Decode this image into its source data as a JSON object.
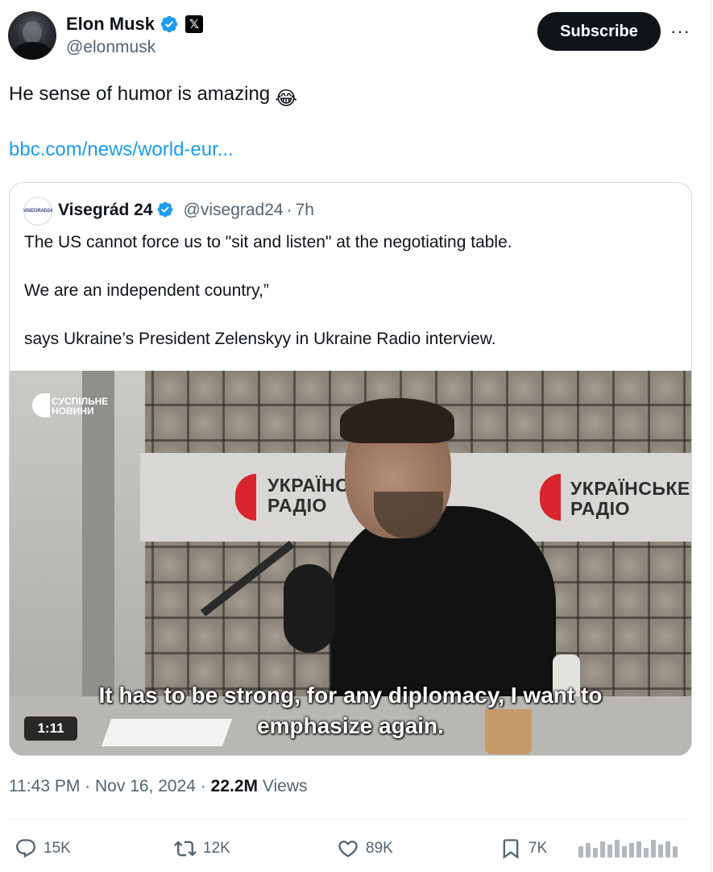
{
  "author": {
    "name": "Elon Musk",
    "handle": "@elonmusk",
    "avatar_icon": "profile-photo",
    "verified_icon": "verified-badge-icon",
    "affiliate_icon": "x-logo-icon",
    "affiliate_letter": "𝕏"
  },
  "header": {
    "subscribe_label": "Subscribe",
    "more_label": "···"
  },
  "tweet": {
    "text": "He sense of humor is amazing",
    "emoji": "😂",
    "link": "bbc.com/news/world-eur..."
  },
  "quote": {
    "avatar_label": "VISEGRAD24",
    "name": "Visegrád 24",
    "handle": "@visegrad24",
    "separator": "·",
    "time": "7h",
    "lines": [
      "The US cannot force us to \"sit and listen\" at the negotiating table.",
      "We are an independent country,”",
      "says Ukraine’s President Zelenskyy in Ukraine Radio interview."
    ],
    "video": {
      "brand_line1": "СУСПІЛЬНЕ",
      "brand_line2": "НОВИНИ",
      "sign_left_line1": "УКРАЇНСЬ",
      "sign_left_line2": "РАДІО",
      "sign_right_line1": "УКРАЇНСЬКЕ",
      "sign_right_line2": "РАДІО",
      "subtitle_line1": "It has to be strong, for any diplomacy, I want to",
      "subtitle_line2": "emphasize again.",
      "duration": "1:11"
    }
  },
  "meta": {
    "time": "11:43 PM",
    "dot": "·",
    "date": "Nov 16, 2024",
    "views_count": "22.2M",
    "views_label": "Views"
  },
  "actions": {
    "replies": "15K",
    "reposts": "12K",
    "likes": "89K",
    "bookmarks": "7K"
  },
  "colors": {
    "accent": "#1d9bf0",
    "text": "#0f1419",
    "secondary": "#536471",
    "button": "#0f1419"
  }
}
